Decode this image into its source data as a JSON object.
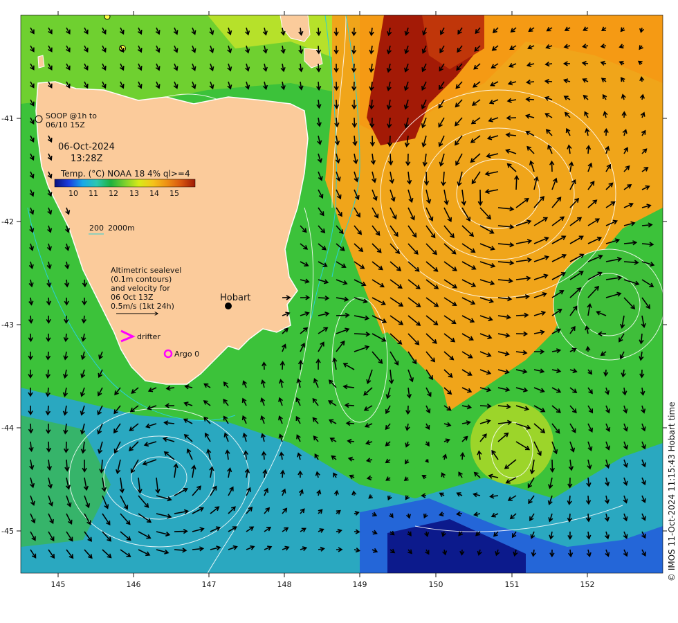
{
  "map": {
    "date": "06-Oct-2024",
    "time": "13:28Z",
    "soop_note": [
      "SOOP @1h to",
      "06/10 15Z"
    ],
    "colorbar": {
      "title": "Temp. (°C) NOAA 18 4% ql>=4",
      "ticks": [
        "10",
        "11",
        "12",
        "13",
        "14",
        "15"
      ],
      "colors": [
        "#08107a",
        "#1a3ce0",
        "#18a8e8",
        "#2cc7b0",
        "#1fb13e",
        "#7cd12c",
        "#d8ea19",
        "#f5c31a",
        "#ee8f14",
        "#d8560e",
        "#9e1a05"
      ]
    },
    "bathymetry": {
      "label1": "200",
      "label2": "2000m"
    },
    "legend_text": [
      "Altimetric sealevel",
      "(0.1m contours)",
      "and velocity for",
      "06 Oct 13Z",
      "0.5m/s (1kt 24h)"
    ],
    "drifter_label": "drifter",
    "argo_label": "Argo 0",
    "city": "Hobart",
    "credit": "© IMOS 11-Oct-2024 11:15:43 Hobart time",
    "x_ticks": [
      "145",
      "146",
      "147",
      "148",
      "149",
      "150",
      "151",
      "152"
    ],
    "y_ticks": [
      "-41",
      "-42",
      "-43",
      "-44",
      "-45"
    ],
    "land_color": "#fbcb9b",
    "drifter_color": "#ff00ff"
  }
}
